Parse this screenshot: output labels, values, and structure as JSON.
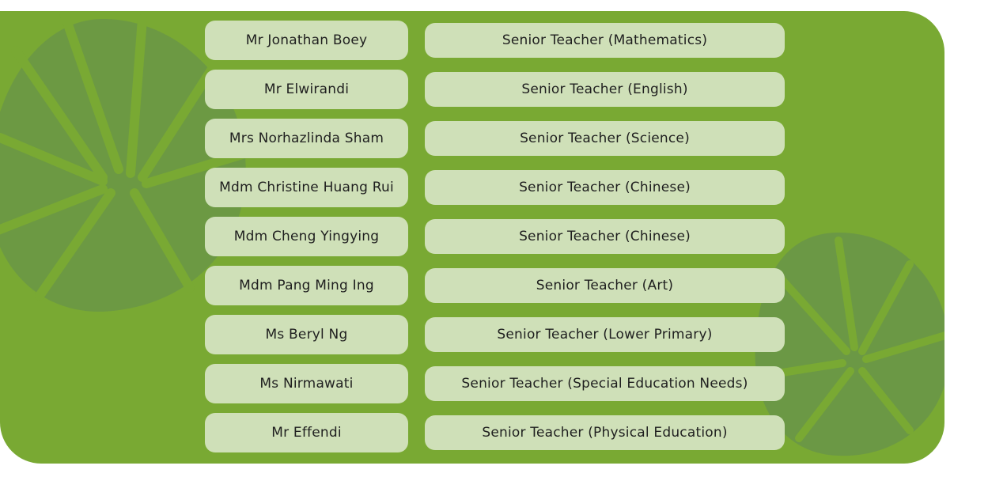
{
  "colors": {
    "panel": "#79a933",
    "leaf": "#68944a",
    "pill": "#cfe0b8",
    "text": "#1f1f1f"
  },
  "staff": [
    {
      "name": "Mr Jonathan Boey",
      "role": "Senior Teacher (Mathematics)"
    },
    {
      "name": "Mr Elwirandi",
      "role": "Senior Teacher (English)"
    },
    {
      "name": "Mrs Norhazlinda Sham",
      "role": "Senior Teacher (Science)"
    },
    {
      "name": "Mdm Christine Huang Rui",
      "role": "Senior Teacher (Chinese)"
    },
    {
      "name": "Mdm Cheng Yingying",
      "role": "Senior Teacher (Chinese)"
    },
    {
      "name": "Mdm Pang Ming Ing",
      "role": "Senior Teacher (Art)"
    },
    {
      "name": "Ms Beryl Ng",
      "role": "Senior Teacher (Lower Primary)"
    },
    {
      "name": "Ms Nirmawati",
      "role": "Senior Teacher (Special Education Needs)"
    },
    {
      "name": "Mr Effendi",
      "role": "Senior Teacher (Physical Education)"
    }
  ]
}
